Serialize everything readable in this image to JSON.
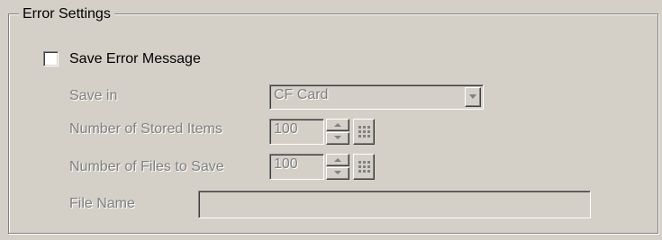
{
  "group": {
    "title": "Error Settings"
  },
  "save_error": {
    "label": "Save Error Message",
    "checked": false
  },
  "save_in": {
    "label": "Save in",
    "value": "CF Card",
    "button_icon": "chevron-down-icon"
  },
  "stored_items": {
    "label": "Number of Stored Items",
    "value": "100",
    "up_icon": "arrow-up-icon",
    "down_icon": "arrow-down-icon",
    "keypad_icon": "keypad-icon"
  },
  "files_to_save": {
    "label": "Number of Files to Save",
    "value": "100",
    "up_icon": "arrow-up-icon",
    "down_icon": "arrow-down-icon",
    "keypad_icon": "keypad-icon"
  },
  "file_name": {
    "label": "File Name",
    "value": ""
  },
  "colors": {
    "face": "#d4d0c8",
    "disabled_text": "#808080",
    "shadow": "#808080",
    "highlight": "#ffffff"
  }
}
